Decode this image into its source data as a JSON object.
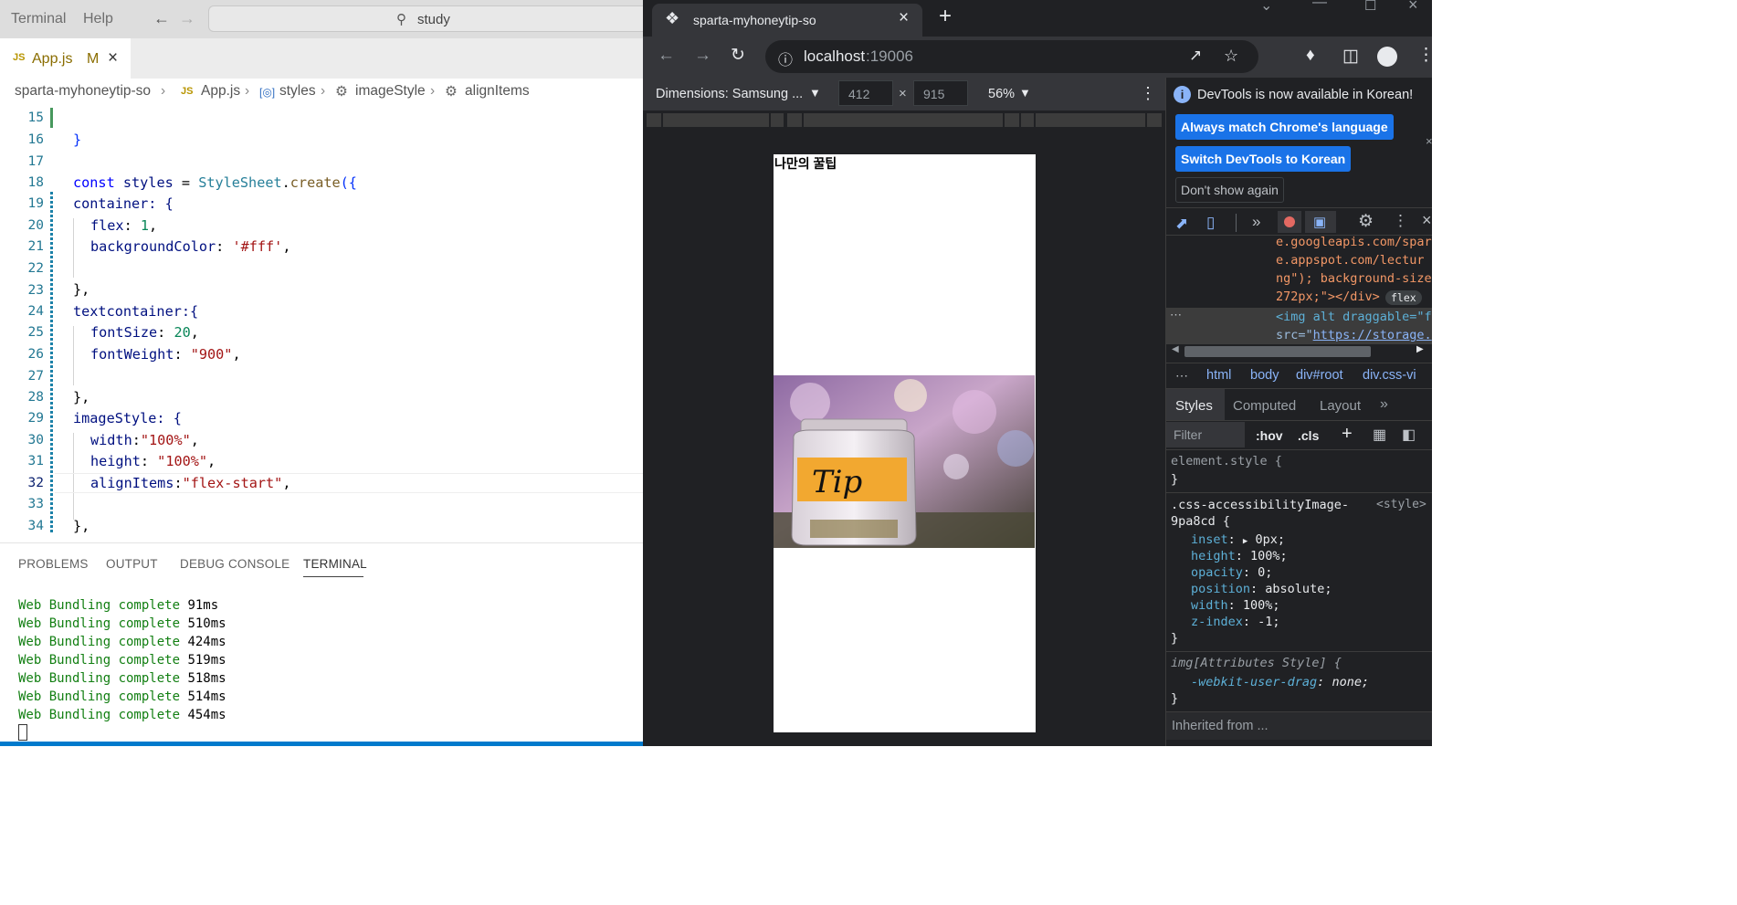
{
  "vscode": {
    "menu": [
      "Terminal",
      "Help"
    ],
    "search_text": "study",
    "tab": {
      "badge": "JS",
      "file": "App.js",
      "status": "M"
    },
    "breadcrumb": {
      "folder": "sparta-myhoneytip-so",
      "badge": "JS",
      "file": "App.js",
      "b3": "styles",
      "b4": "imageStyle",
      "b5": "alignItems"
    },
    "line_numbers": [
      "15",
      "16",
      "17",
      "18",
      "19",
      "20",
      "21",
      "22",
      "23",
      "24",
      "25",
      "26",
      "27",
      "28",
      "29",
      "30",
      "31",
      "32",
      "33",
      "34"
    ],
    "code": {
      "l16": "}",
      "l18_kw": "const",
      "l18_var": "styles",
      "l18_eq": " = ",
      "l18_type": "StyleSheet",
      "l18_dot": ".",
      "l18_fn": "create",
      "l18_tail": "({",
      "l19": "container: {",
      "l20_key": "flex",
      "l20_colon": ": ",
      "l20_val": "1",
      "l20_end": ",",
      "l21_key": "backgroundColor",
      "l21_colon": ": ",
      "l21_val": "'#fff'",
      "l21_end": ",",
      "l23": "},",
      "l24": "textcontainer:{",
      "l25_key": "fontSize",
      "l25_colon": ": ",
      "l25_val": "20",
      "l25_end": ",",
      "l26_key": "fontWeight",
      "l26_colon": ": ",
      "l26_val": "\"900\"",
      "l26_end": ",",
      "l28": "},",
      "l29": "imageStyle: {",
      "l30_key": "width",
      "l30_colon": ":",
      "l30_val": "\"100%\"",
      "l30_end": ",",
      "l31_key": "height",
      "l31_colon": ": ",
      "l31_val": "\"100%\"",
      "l31_end": ",",
      "l32_key": "alignItems",
      "l32_colon": ":",
      "l32_val": "\"flex-start\"",
      "l32_end": ",",
      "l34": "},"
    },
    "panel_tabs": [
      "PROBLEMS",
      "OUTPUT",
      "DEBUG CONSOLE",
      "TERMINAL"
    ],
    "terminal_lines": [
      {
        "label": "Web Bundling complete",
        "time": "91ms"
      },
      {
        "label": "Web Bundling complete",
        "time": "510ms"
      },
      {
        "label": "Web Bundling complete",
        "time": "424ms"
      },
      {
        "label": "Web Bundling complete",
        "time": "519ms"
      },
      {
        "label": "Web Bundling complete",
        "time": "518ms"
      },
      {
        "label": "Web Bundling complete",
        "time": "514ms"
      },
      {
        "label": "Web Bundling complete",
        "time": "454ms"
      }
    ]
  },
  "chrome": {
    "tab_title": "sparta-myhoneytip-so",
    "url_host": "localhost",
    "url_port": ":19006",
    "device": "Dimensions: Samsung ...",
    "width": "412",
    "height": "915",
    "times": "×",
    "zoom": "56%",
    "page_title": "나만의 꿀팁",
    "tip_text": "Tip"
  },
  "devtools": {
    "notice": "DevTools is now available in Korean!",
    "btn_match": "Always match Chrome's language",
    "btn_switch": "Switch DevTools to Korean",
    "btn_dont": "Don't show again",
    "elements": {
      "e1": "e.googleapis.com/spar",
      "e2": "e.appspot.com/lectur",
      "e3": "ng\"); background-size",
      "e4": "272px;\"></div>",
      "e4_badge": "flex",
      "e5": "<img alt draggable=\"f",
      "e6_attr": "src=\"",
      "e6_link": "https://storage."
    },
    "dom_path": [
      "html",
      "body",
      "div#root",
      "div.css-vi"
    ],
    "style_tabs": [
      "Styles",
      "Computed",
      "Layout"
    ],
    "filter_placeholder": "Filter",
    "hov": ":hov",
    "cls": ".cls",
    "element_style": "element.style {",
    "close_brace": "}",
    "rule1_selector": ".css-accessibilityImage-",
    "rule1_selector2": "9pa8cd {",
    "rule1_source": "<style>",
    "rule1_props": [
      {
        "k": "inset",
        "v": "0px;"
      },
      {
        "k": "height",
        "v": "100%;"
      },
      {
        "k": "opacity",
        "v": "0;"
      },
      {
        "k": "position",
        "v": "absolute;"
      },
      {
        "k": "width",
        "v": "100%;"
      },
      {
        "k": "z-index",
        "v": "-1;"
      }
    ],
    "rule2_selector": "img[Attributes Style] {",
    "rule2_prop": "-webkit-user-drag",
    "rule2_val": "none;",
    "inherited": "Inherited from ..."
  }
}
